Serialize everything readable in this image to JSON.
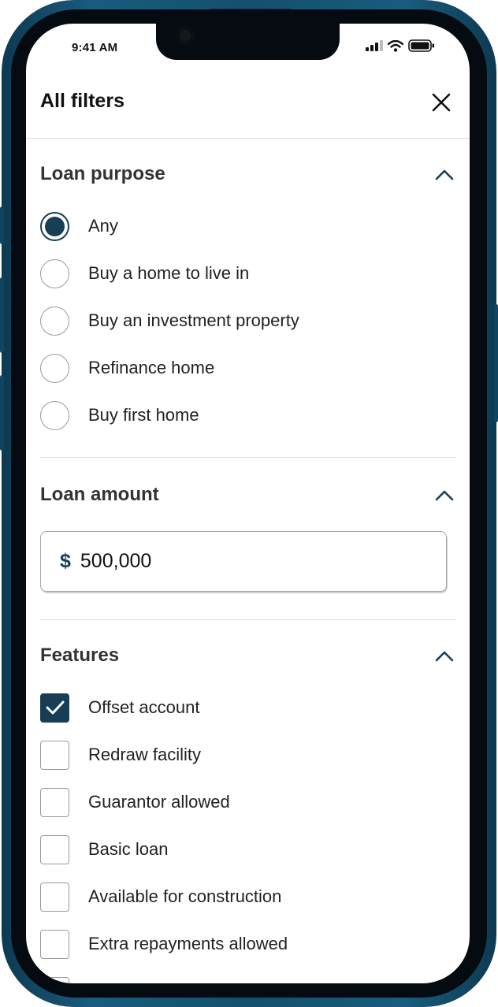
{
  "status_bar": {
    "time": "9:41 AM"
  },
  "header": {
    "title": "All filters"
  },
  "loan_purpose": {
    "title": "Loan purpose",
    "options": [
      {
        "label": "Any",
        "selected": true
      },
      {
        "label": "Buy a home to live in",
        "selected": false
      },
      {
        "label": "Buy an investment property",
        "selected": false
      },
      {
        "label": "Refinance home",
        "selected": false
      },
      {
        "label": "Buy first home",
        "selected": false
      }
    ]
  },
  "loan_amount": {
    "title": "Loan amount",
    "currency_symbol": "$",
    "value": "500,000"
  },
  "features": {
    "title": "Features",
    "options": [
      {
        "label": "Offset account",
        "checked": true
      },
      {
        "label": "Redraw facility",
        "checked": false
      },
      {
        "label": "Guarantor allowed",
        "checked": false
      },
      {
        "label": "Basic loan",
        "checked": false
      },
      {
        "label": "Available for construction",
        "checked": false
      },
      {
        "label": "Extra repayments allowed",
        "checked": false
      }
    ]
  },
  "colors": {
    "accent": "#173e55",
    "frame": "#14506f"
  },
  "icons": {
    "close": "close-icon",
    "collapse": "chevron-up-icon",
    "check": "check-icon"
  }
}
